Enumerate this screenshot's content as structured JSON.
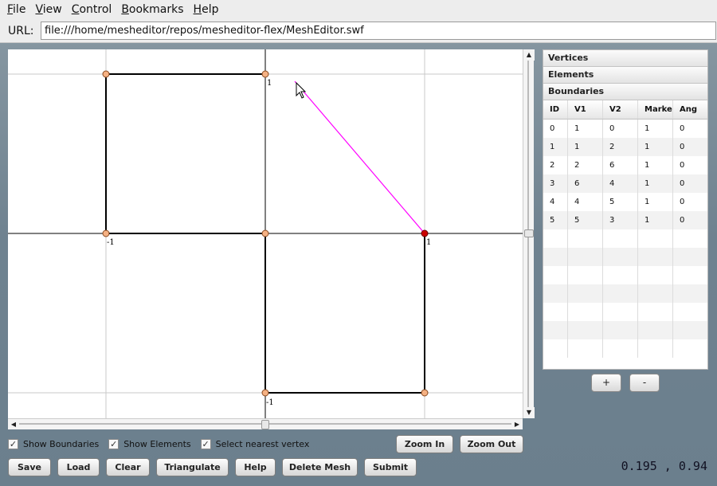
{
  "menubar": {
    "items": [
      {
        "label_u": "F",
        "label_rest": "ile"
      },
      {
        "label_u": "V",
        "label_rest": "iew"
      },
      {
        "label_u": "C",
        "label_rest": "ontrol"
      },
      {
        "label_u": "B",
        "label_rest": "ookmarks"
      },
      {
        "label_u": "H",
        "label_rest": "elp"
      }
    ]
  },
  "urlbar": {
    "label": "URL:",
    "value": "file:///home/mesheditor/repos/mesheditor-flex/MeshEditor.swf"
  },
  "canvas": {
    "labels": {
      "top_one": "1",
      "left_neg_one": "-1",
      "right_one": "1",
      "bottom_neg_one": "-1"
    },
    "colors": {
      "vertex_fill": "#f5b183",
      "selected_vertex_fill": "#cc0000",
      "edge": "#000000",
      "guide_line": "#ff00ff",
      "grid": "#c8c8c8"
    }
  },
  "panel": {
    "accordion": [
      "Vertices",
      "Elements",
      "Boundaries"
    ],
    "columns": [
      "ID",
      "V1",
      "V2",
      "Marke",
      "Ang"
    ],
    "rows": [
      [
        "0",
        "1",
        "0",
        "1",
        "0"
      ],
      [
        "1",
        "1",
        "2",
        "1",
        "0"
      ],
      [
        "2",
        "2",
        "6",
        "1",
        "0"
      ],
      [
        "3",
        "6",
        "4",
        "1",
        "0"
      ],
      [
        "4",
        "4",
        "5",
        "1",
        "0"
      ],
      [
        "5",
        "5",
        "3",
        "1",
        "0"
      ]
    ],
    "add_label": "+",
    "remove_label": "-"
  },
  "options": {
    "show_boundaries": {
      "label": "Show Boundaries",
      "checked": true
    },
    "show_elements": {
      "label": "Show Elements",
      "checked": true
    },
    "select_nearest": {
      "label": "Select nearest vertex",
      "checked": true
    }
  },
  "zoom": {
    "in": "Zoom In",
    "out": "Zoom Out"
  },
  "buttons": {
    "save": "Save",
    "load": "Load",
    "clear": "Clear",
    "triangulate": "Triangulate",
    "help": "Help",
    "delete_mesh": "Delete Mesh",
    "submit": "Submit"
  },
  "status": {
    "coords": "0.195 , 0.94"
  }
}
